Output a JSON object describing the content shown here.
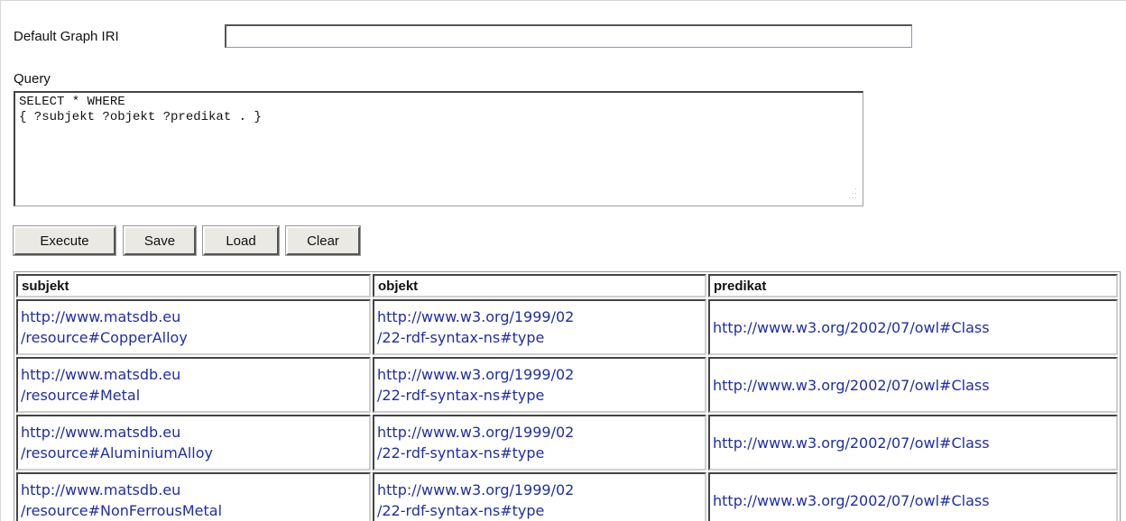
{
  "form": {
    "default_graph_label": "Default Graph IRI",
    "default_graph_value": "",
    "query_label": "Query",
    "query_text": "SELECT * WHERE\n{ ?subjekt ?objekt ?predikat . }"
  },
  "buttons": {
    "execute": "Execute",
    "save": "Save",
    "load": "Load",
    "clear": "Clear"
  },
  "results": {
    "headers": [
      "subjekt",
      "objekt",
      "predikat"
    ],
    "rows": [
      {
        "subjekt_1": "http://www.matsdb.eu",
        "subjekt_2": "/resource#CopperAlloy",
        "objekt_1": "http://www.w3.org/1999/02",
        "objekt_2": "/22-rdf-syntax-ns#type",
        "predikat": "http://www.w3.org/2002/07/owl#Class"
      },
      {
        "subjekt_1": "http://www.matsdb.eu",
        "subjekt_2": "/resource#Metal",
        "objekt_1": "http://www.w3.org/1999/02",
        "objekt_2": "/22-rdf-syntax-ns#type",
        "predikat": "http://www.w3.org/2002/07/owl#Class"
      },
      {
        "subjekt_1": "http://www.matsdb.eu",
        "subjekt_2": "/resource#AluminiumAlloy",
        "objekt_1": "http://www.w3.org/1999/02",
        "objekt_2": "/22-rdf-syntax-ns#type",
        "predikat": "http://www.w3.org/2002/07/owl#Class"
      },
      {
        "subjekt_1": "http://www.matsdb.eu",
        "subjekt_2": "/resource#NonFerrousMetal",
        "objekt_1": "http://www.w3.org/1999/02",
        "objekt_2": "/22-rdf-syntax-ns#type",
        "predikat": "http://www.w3.org/2002/07/owl#Class"
      }
    ]
  },
  "colors": {
    "link": "#1f2ea8",
    "button_face": "#ebe9e4"
  },
  "icons": {
    "resize_grip": "resize-grip-icon"
  }
}
